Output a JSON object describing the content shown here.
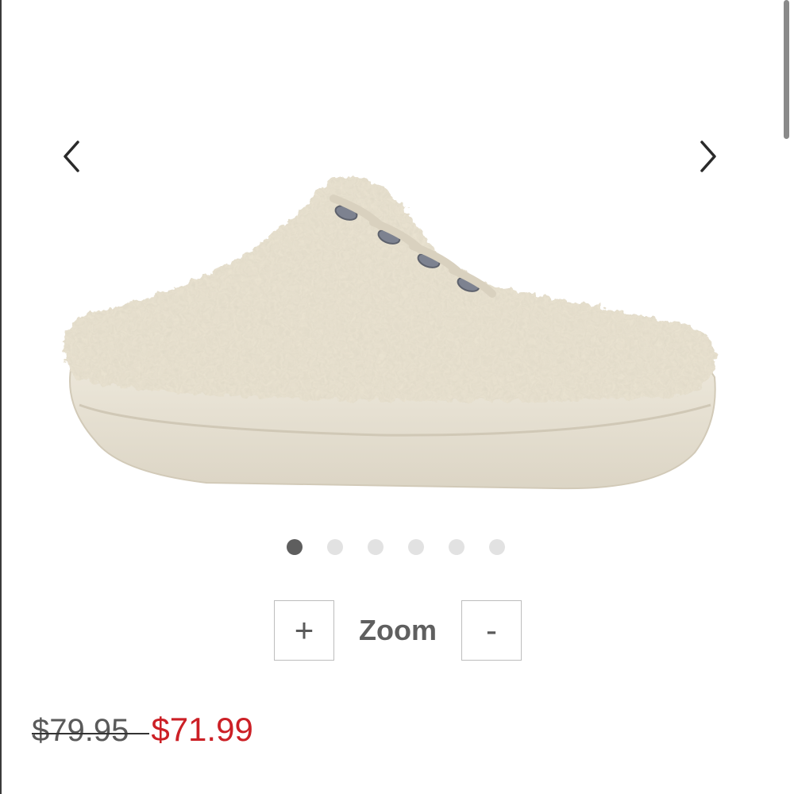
{
  "carousel": {
    "prev_icon": "chevron-left-icon",
    "next_icon": "chevron-right-icon",
    "image": "beige sherpa slip-on sneaker mule",
    "dots_total": 6,
    "active_dot": 1
  },
  "zoom": {
    "plus_label": "+",
    "label": "Zoom",
    "minus_label": "-"
  },
  "price": {
    "original": "$79.95",
    "sale": "$71.99",
    "sale_color": "#cc2026"
  }
}
